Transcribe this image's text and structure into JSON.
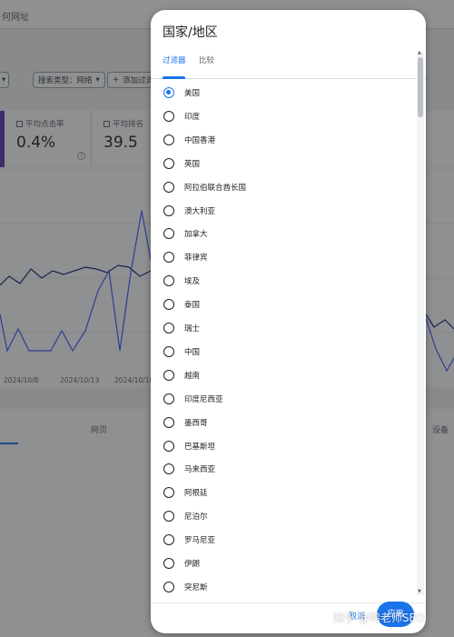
{
  "background": {
    "page_title": "何网址",
    "filters": {
      "search_type": "搜索类型：网络",
      "add_filter": "添加过滤"
    },
    "metrics": [
      {
        "label": "平均点击率",
        "value": "0.4%"
      },
      {
        "label": "平均排名",
        "value": "39.5"
      }
    ],
    "chart": {
      "x_ticks": [
        "2024/10/8",
        "2024/10/13",
        "2024/10/18"
      ]
    },
    "tabs": {
      "pages": "网页",
      "devices": "设备"
    }
  },
  "dialog": {
    "title": "国家/地区",
    "tabs": [
      {
        "label": "过滤器",
        "active": true
      },
      {
        "label": "比较",
        "active": false
      }
    ],
    "countries": [
      {
        "label": "美国",
        "selected": true
      },
      {
        "label": "印度",
        "selected": false
      },
      {
        "label": "中国香港",
        "selected": false
      },
      {
        "label": "英国",
        "selected": false
      },
      {
        "label": "阿拉伯联合酋长国",
        "selected": false
      },
      {
        "label": "澳大利亚",
        "selected": false
      },
      {
        "label": "加拿大",
        "selected": false
      },
      {
        "label": "菲律宾",
        "selected": false
      },
      {
        "label": "埃及",
        "selected": false
      },
      {
        "label": "泰国",
        "selected": false
      },
      {
        "label": "瑞士",
        "selected": false
      },
      {
        "label": "中国",
        "selected": false
      },
      {
        "label": "越南",
        "selected": false
      },
      {
        "label": "印度尼西亚",
        "selected": false
      },
      {
        "label": "墨西哥",
        "selected": false
      },
      {
        "label": "巴基斯坦",
        "selected": false
      },
      {
        "label": "马来西亚",
        "selected": false
      },
      {
        "label": "阿根廷",
        "selected": false
      },
      {
        "label": "尼泊尔",
        "selected": false
      },
      {
        "label": "罗马尼亚",
        "selected": false
      },
      {
        "label": "伊朗",
        "selected": false
      },
      {
        "label": "突尼斯",
        "selected": false
      }
    ],
    "cancel_label": "取消",
    "apply_label": "应用"
  },
  "watermark": "知乎 @鸭老师SEO",
  "colors": {
    "accent": "#1a73e8",
    "ctr_metric": "#5e35b1",
    "overlay": "rgba(32,33,36,0.5)"
  }
}
